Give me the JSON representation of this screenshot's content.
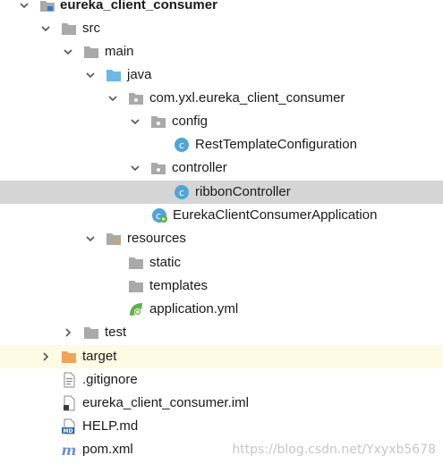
{
  "tree": {
    "nodes": [
      {
        "label": "eureka_client_consumer",
        "icon": "module-folder-icon",
        "expanded": true
      },
      {
        "label": "src",
        "icon": "folder-icon",
        "expanded": true
      },
      {
        "label": "main",
        "icon": "folder-icon",
        "expanded": true
      },
      {
        "label": "java",
        "icon": "source-root-folder-icon",
        "expanded": true
      },
      {
        "label": "com.yxl.eureka_client_consumer",
        "icon": "package-icon",
        "expanded": true
      },
      {
        "label": "config",
        "icon": "package-icon",
        "expanded": true
      },
      {
        "label": "RestTemplateConfiguration",
        "icon": "class-icon"
      },
      {
        "label": "controller",
        "icon": "package-icon",
        "expanded": true
      },
      {
        "label": "ribbonController",
        "icon": "class-icon",
        "selected": true
      },
      {
        "label": "EurekaClientConsumerApplication",
        "icon": "spring-boot-app-icon"
      },
      {
        "label": "resources",
        "icon": "resources-folder-icon",
        "expanded": true
      },
      {
        "label": "static",
        "icon": "folder-icon"
      },
      {
        "label": "templates",
        "icon": "folder-icon"
      },
      {
        "label": "application.yml",
        "icon": "spring-config-icon"
      },
      {
        "label": "test",
        "icon": "folder-icon",
        "expanded": false
      },
      {
        "label": "target",
        "icon": "excluded-folder-icon",
        "expanded": false,
        "highlighted": true
      },
      {
        "label": ".gitignore",
        "icon": "text-file-icon"
      },
      {
        "label": "eureka_client_consumer.iml",
        "icon": "iml-file-icon"
      },
      {
        "label": "HELP.md",
        "icon": "markdown-file-icon"
      },
      {
        "label": "pom.xml",
        "icon": "maven-icon"
      }
    ]
  },
  "watermark": "https://blog.csdn.net/Yxyxb5678",
  "colors": {
    "folder": "#a9a9a9",
    "source_root": "#6cb8e6",
    "excluded_folder": "#f0a35a",
    "class_icon": "#4ea5d8",
    "spring_green": "#5fb246",
    "selection": "#d5d5d5",
    "highlight": "#fdfbe3",
    "maven": "#6d8fd6"
  }
}
